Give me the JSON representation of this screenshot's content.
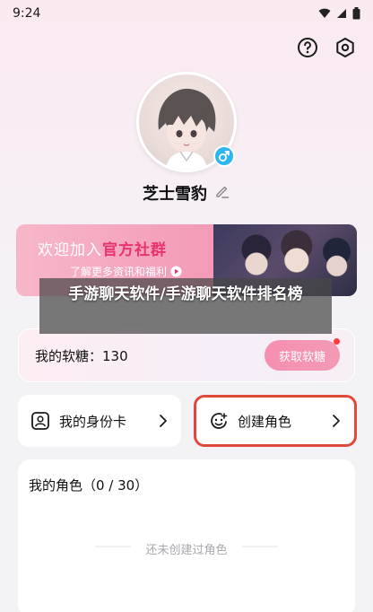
{
  "status_bar": {
    "time": "9:24"
  },
  "profile": {
    "username": "芝士雪豹"
  },
  "banner": {
    "title_part1": "欢迎加入",
    "title_part2": "官方社群",
    "subtitle": "了解更多资讯和福利"
  },
  "overlay": {
    "caption": "手游聊天软件/手游聊天软件排名榜"
  },
  "candy": {
    "label": "我的软糖：130",
    "button_label": "获取软糖"
  },
  "cards": {
    "id_card_label": "我的身份卡",
    "create_role_label": "创建角色"
  },
  "roles": {
    "title": "我的角色（0 / 30）",
    "empty_text": "还未创建过角色"
  },
  "colors": {
    "accent_pink": "#f58fb1",
    "highlight_red": "#e0483a",
    "gender_blue": "#2fb5f0"
  }
}
